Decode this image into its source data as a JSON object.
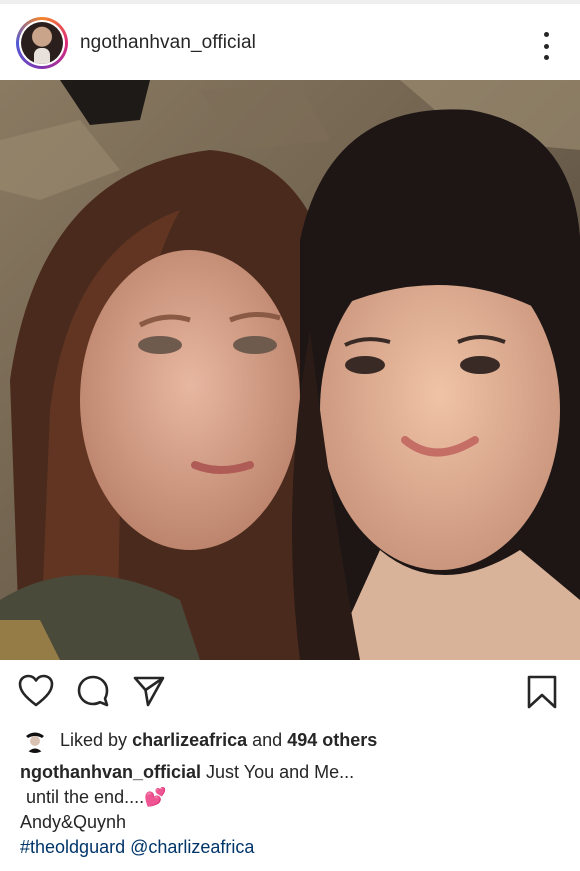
{
  "post": {
    "username": "ngothanhvan_official"
  },
  "icons": {
    "more": "more-options-icon",
    "like": "heart-outline-icon",
    "comment": "comment-bubble-icon",
    "share": "paper-plane-icon",
    "save": "bookmark-icon"
  },
  "likes": {
    "prefix": "Liked by",
    "user": "charlizeafrica",
    "joiner": "and",
    "others": "494 others"
  },
  "caption": {
    "author": "ngothanhvan_official",
    "line1": "Just You and Me...",
    "line2": "until the end....",
    "emoji": "💕",
    "line3": "Andy&Quynh",
    "hashtag": "#theoldguard",
    "mention": "@charlizeafrica"
  },
  "colors": {
    "text": "#262626",
    "link": "#003569",
    "heart_emoji": "#ff4fa7"
  }
}
